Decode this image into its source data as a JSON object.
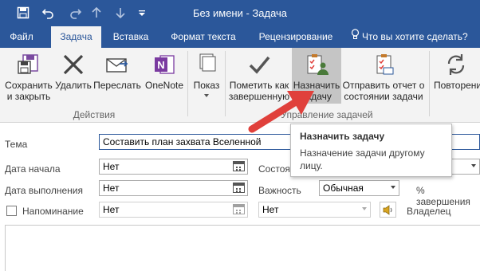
{
  "window": {
    "title": "Без имени - Задача"
  },
  "tabs": [
    "Файл",
    "Задача",
    "Вставка",
    "Формат текста",
    "Рецензирование"
  ],
  "tell_me": "Что вы хотите сделать?",
  "ribbon": {
    "save_close": "Сохранить\nи закрыть",
    "delete": "Удалить",
    "forward": "Переслать",
    "onenote": "OneNote",
    "show": "Показ",
    "mark_complete": "Пометить как\nзавершенную",
    "assign": "Назначить\nзадачу",
    "send_status": "Отправить отчет о\nсостоянии задачи",
    "recurrence": "Повторени",
    "group_actions": "Действия",
    "group_manage": "Управление задачей"
  },
  "tooltip": {
    "title": "Назначить задачу",
    "body": "Назначение задачи другому лицу."
  },
  "form": {
    "subject_label": "Тема",
    "subject_value": "Составить план захвата Вселенной",
    "start_label": "Дата начала",
    "start_value": "Нет",
    "due_label": "Дата выполнения",
    "due_value": "Нет",
    "status_label": "Состоян",
    "priority_label": "Важность",
    "priority_value": "Обычная",
    "percent_label": "% завершения",
    "reminder_label": "Напоминание",
    "reminder_date": "Нет",
    "reminder_time": "Нет",
    "owner_label": "Владелец"
  },
  "colors": {
    "accent": "#2b579a",
    "arrow": "#e0403b",
    "tab_active_bg": "#f3f3f3"
  }
}
